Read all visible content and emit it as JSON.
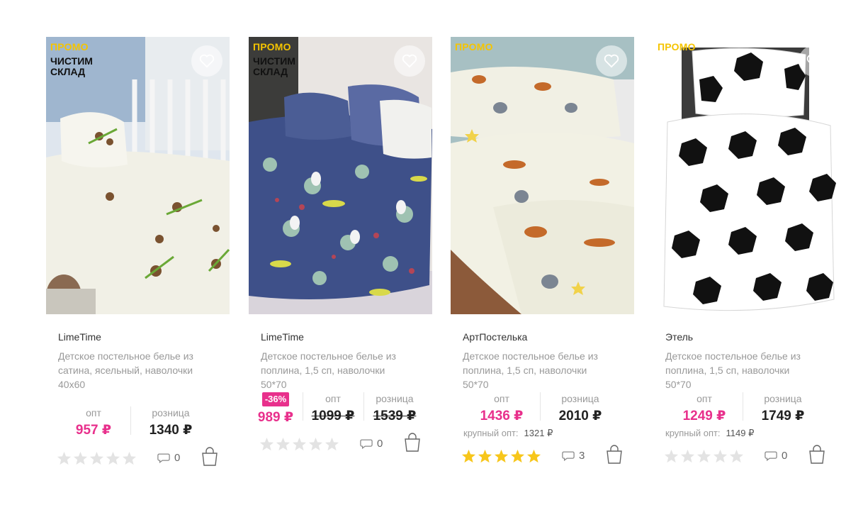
{
  "products": [
    {
      "promo": "ПРОМО",
      "stock_label": "ЧИСТИМ СКЛАД",
      "brand": "LimeTime",
      "description": "Детское постельное белье из сатина, ясельный, наволочки 40х60",
      "discount": "",
      "opt_label": "опт",
      "retail_label": "розница",
      "opt_price": "957 ₽",
      "retail_price": "1340 ₽",
      "bulk_label": "",
      "bulk_price": "",
      "rating": 0,
      "reviews": "0",
      "image": {
        "bg": "#f2f1ea",
        "pattern": "panda"
      }
    },
    {
      "promo": "ПРОМО",
      "stock_label": "ЧИСТИМ СКЛАД",
      "brand": "LimeTime",
      "description": "Детское постельное белье из поплина, 1,5 сп, наволочки 50*70",
      "discount": "-36%",
      "opt_label": "опт",
      "retail_label": "розница",
      "sale_price": "989 ₽",
      "opt_price": "1099 ₽",
      "retail_price": "1539 ₽",
      "bulk_label": "",
      "bulk_price": "",
      "rating": 0,
      "reviews": "0",
      "image": {
        "bg": "#3d4f8a",
        "pattern": "space"
      }
    },
    {
      "promo": "ПРОМО",
      "stock_label": "",
      "brand": "АртПостелька",
      "description": "Детское постельное белье из поплина, 1,5 сп, наволочки 50*70",
      "discount": "",
      "opt_label": "опт",
      "retail_label": "розница",
      "opt_price": "1436 ₽",
      "retail_price": "2010 ₽",
      "bulk_label": "крупный опт:",
      "bulk_price": "1321 ₽",
      "rating": 5,
      "reviews": "3",
      "image": {
        "bg": "#ecece0",
        "pattern": "dogs"
      }
    },
    {
      "promo": "ПРОМО",
      "stock_label": "",
      "brand": "Этель",
      "description": "Детское постельное белье из поплина, 1,5 сп, наволочки 50*70",
      "discount": "",
      "opt_label": "опт",
      "retail_label": "розница",
      "opt_price": "1249 ₽",
      "retail_price": "1749 ₽",
      "bulk_label": "крупный опт:",
      "bulk_price": "1149 ₽",
      "rating": 0,
      "reviews": "0",
      "image": {
        "bg": "#ffffff",
        "pattern": "football"
      }
    }
  ],
  "icons": {
    "favorite": "heart-icon",
    "reviews": "speech-bubble-icon",
    "cart": "shopping-bag-icon",
    "rating": "star-icon"
  },
  "colors": {
    "promo": "#f5c400",
    "price_accent": "#e8308c",
    "star_active": "#f7c61b",
    "star_inactive": "#e3e3e3"
  }
}
